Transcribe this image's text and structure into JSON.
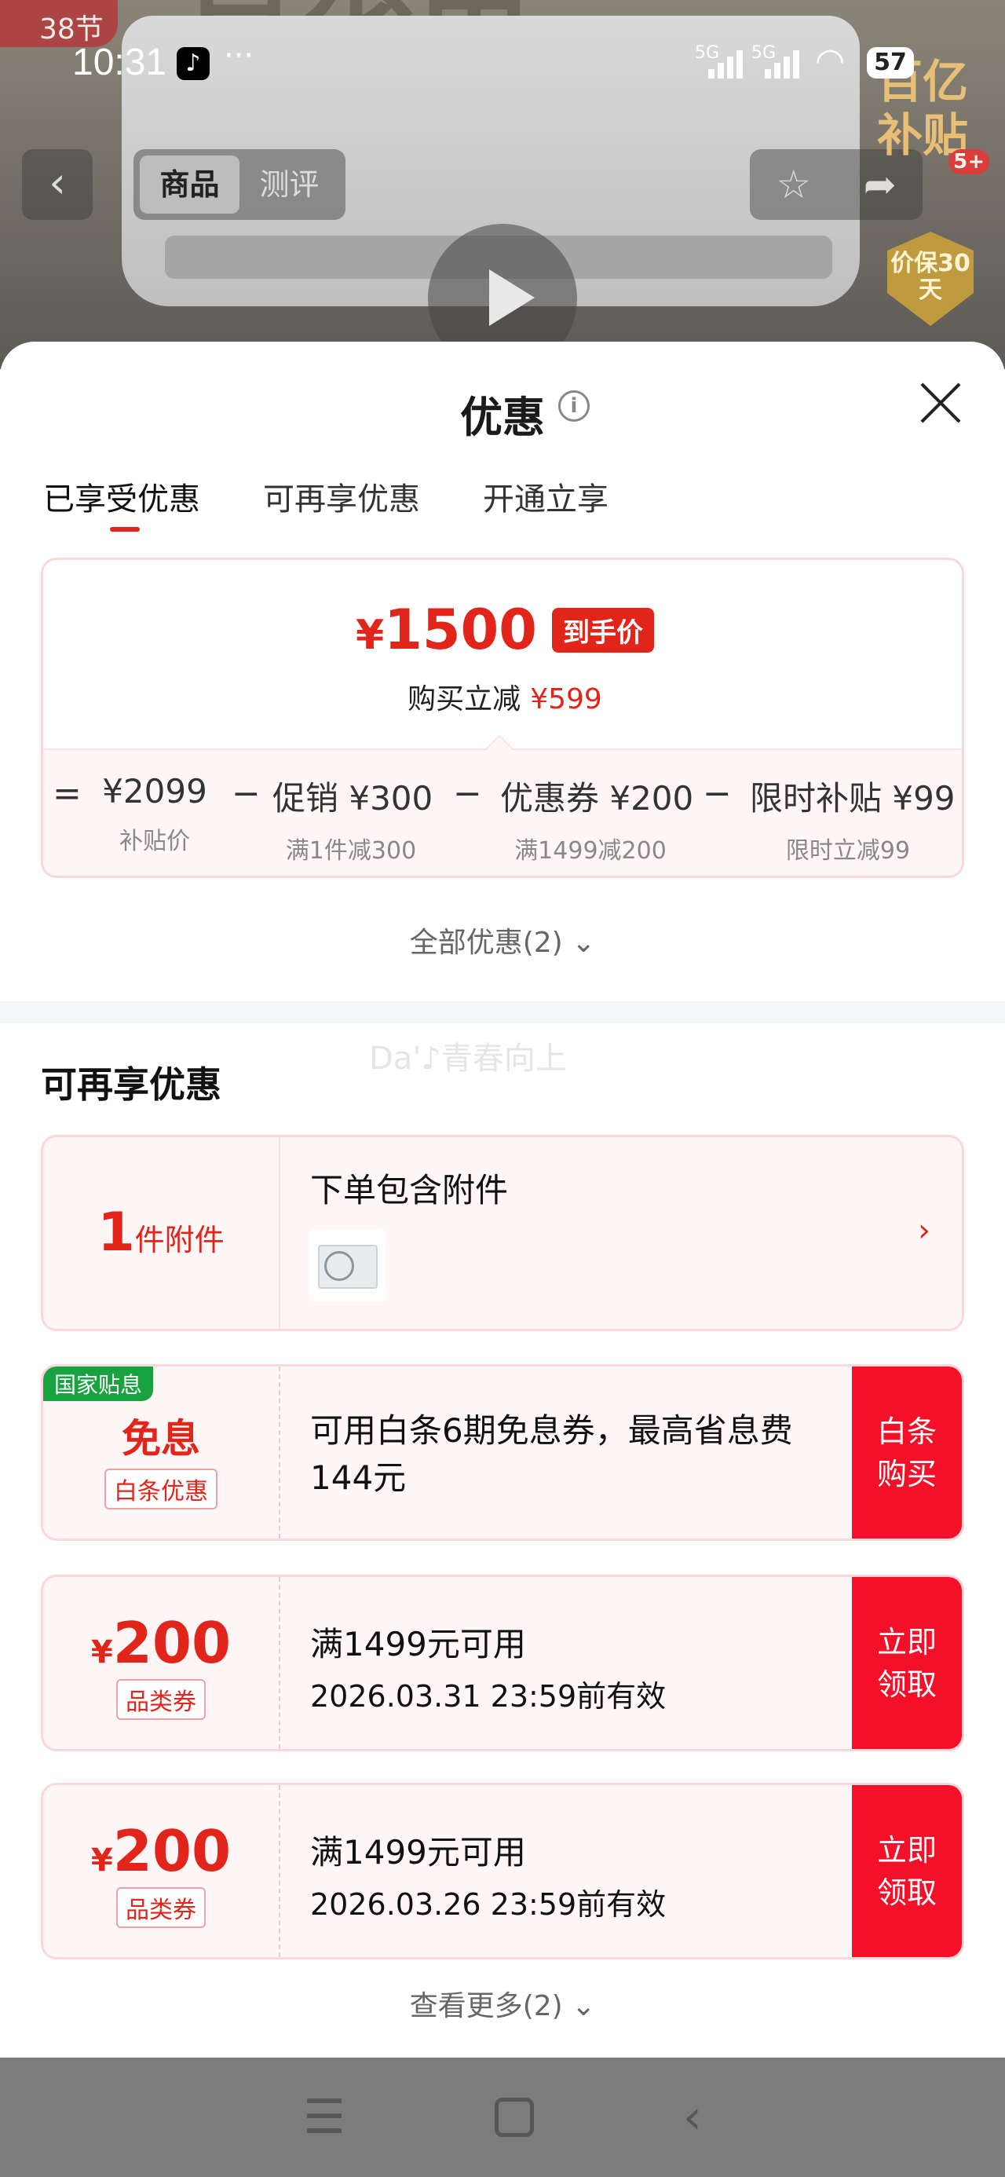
{
  "status_bar": {
    "time": "10:31",
    "signal1": "5G",
    "signal2": "5G",
    "battery": "57",
    "more": "···"
  },
  "background": {
    "festival": "38节",
    "segments": [
      "商品",
      "测评"
    ],
    "subsidy_text": "百亿补贴",
    "subsidy_badge": "5+",
    "guarantee": "价保30天"
  },
  "sheet": {
    "title": "优惠",
    "tabs": [
      {
        "label": "已享受优惠",
        "active": true
      },
      {
        "label": "可再享优惠",
        "active": false
      },
      {
        "label": "开通立享",
        "active": false
      }
    ],
    "summary": {
      "currency": "¥",
      "final_price": "1500",
      "final_tag": "到手价",
      "reduce_label": "购买立减",
      "reduce_value": "¥599",
      "breakdown": [
        {
          "op": "=",
          "value": "¥2099",
          "label": "补贴价"
        },
        {
          "op": "−",
          "value": "促销 ¥300",
          "label": "满1件减300"
        },
        {
          "op": "−",
          "value": "优惠券 ¥200",
          "label": "满1499减200"
        },
        {
          "op": "−",
          "value": "限时补贴 ¥99",
          "label": "限时立减99"
        }
      ]
    },
    "all_discounts": "全部优惠(2)",
    "watermark": "Da'♪青春向上",
    "section_title": "可再享优惠",
    "cards": [
      {
        "kind": "accessory",
        "count": "1",
        "unit": "件附件",
        "title": "下单包含附件"
      },
      {
        "kind": "interest",
        "badge": "国家贴息",
        "big": "免息",
        "chip": "白条优惠",
        "title": "可用白条6期免息券，最高省息费144元",
        "action": "白条购买"
      },
      {
        "kind": "coupon",
        "currency": "¥",
        "amount": "200",
        "chip": "品类券",
        "title": "满1499元可用",
        "expiry": "2026.03.31 23:59前有效",
        "action": "立即领取"
      },
      {
        "kind": "coupon",
        "currency": "¥",
        "amount": "200",
        "chip": "品类券",
        "title": "满1499元可用",
        "expiry": "2026.03.26 23:59前有效",
        "action": "立即领取"
      }
    ],
    "see_more": "查看更多(2)"
  },
  "colors": {
    "accent": "#e1251b",
    "action_bg": "#f5102a",
    "card_border": "#fad7d9",
    "badge_green": "#18a340"
  }
}
